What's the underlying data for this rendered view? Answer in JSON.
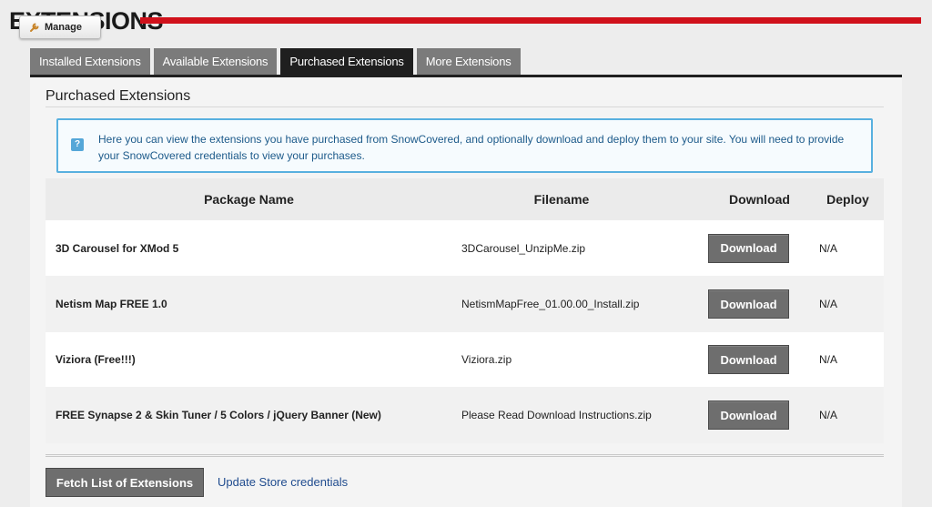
{
  "header": {
    "title": "EXTENSIONS",
    "manage_label": "Manage",
    "accent_color": "#d0111b"
  },
  "tabs": [
    {
      "label": "Installed Extensions",
      "active": false
    },
    {
      "label": "Available Extensions",
      "active": false
    },
    {
      "label": "Purchased Extensions",
      "active": true
    },
    {
      "label": "More Extensions",
      "active": false
    }
  ],
  "section": {
    "title": "Purchased Extensions",
    "info_icon": "help-icon",
    "info_text": "Here you can view the extensions you have purchased from SnowCovered, and optionally download and deploy them to your site. You will need to provide your SnowCovered credentials to view your purchases."
  },
  "grid": {
    "headers": {
      "name": "Package Name",
      "file": "Filename",
      "download": "Download",
      "deploy": "Deploy"
    },
    "rows": [
      {
        "name": "3D Carousel for XMod 5",
        "file": "3DCarousel_UnzipMe.zip",
        "download": "Download",
        "deploy": "N/A"
      },
      {
        "name": "Netism Map FREE 1.0",
        "file": "NetismMapFree_01.00.00_Install.zip",
        "download": "Download",
        "deploy": "N/A"
      },
      {
        "name": "Viziora (Free!!!)",
        "file": "Viziora.zip",
        "download": "Download",
        "deploy": "N/A"
      },
      {
        "name": "FREE Synapse 2 & Skin Tuner / 5 Colors / jQuery Banner (New)",
        "file": "Please Read Download Instructions.zip",
        "download": "Download",
        "deploy": "N/A"
      }
    ]
  },
  "footer": {
    "fetch_label": "Fetch List of Extensions",
    "update_link": "Update Store credentials"
  }
}
